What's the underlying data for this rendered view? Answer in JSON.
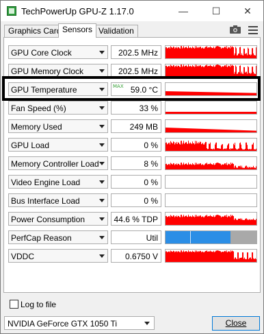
{
  "window": {
    "title": "TechPowerUp GPU-Z 1.17.0",
    "minimize_glyph": "—",
    "maximize_glyph": "☐",
    "close_glyph": "✕"
  },
  "tabs": [
    {
      "label": "Graphics Card",
      "active": false
    },
    {
      "label": "Sensors",
      "active": true
    },
    {
      "label": "Validation",
      "active": false
    }
  ],
  "toolbar": {
    "camera_icon": "camera-icon",
    "menu_icon": "menu-icon"
  },
  "colors": {
    "graph_red": "#ff0000",
    "perfcap_blue": "#2b8ee6",
    "perfcap_gray": "#a9a9a9",
    "max_tag_green": "#3aa23a"
  },
  "sensors": [
    {
      "label": "GPU Core Clock",
      "value": "202.5 MHz",
      "max_tag": "",
      "graph": "core"
    },
    {
      "label": "GPU Memory Clock",
      "value": "202.5 MHz",
      "max_tag": "",
      "graph": "memclock"
    },
    {
      "label": "GPU Temperature",
      "value": "59.0 °C",
      "max_tag": "MAX",
      "graph": "temp",
      "highlighted": true
    },
    {
      "label": "Fan Speed (%)",
      "value": "33 %",
      "max_tag": "",
      "graph": "fan"
    },
    {
      "label": "Memory Used",
      "value": "249 MB",
      "max_tag": "",
      "graph": "memused"
    },
    {
      "label": "GPU Load",
      "value": "0 %",
      "max_tag": "",
      "graph": "load"
    },
    {
      "label": "Memory Controller Load",
      "value": "8 %",
      "max_tag": "",
      "graph": "mcload"
    },
    {
      "label": "Video Engine Load",
      "value": "0 %",
      "max_tag": "",
      "graph": "empty"
    },
    {
      "label": "Bus Interface Load",
      "value": "0 %",
      "max_tag": "",
      "graph": "empty"
    },
    {
      "label": "Power Consumption",
      "value": "44.6 % TDP",
      "max_tag": "",
      "graph": "power"
    },
    {
      "label": "PerfCap Reason",
      "value": "Util",
      "max_tag": "",
      "graph": "perfcap"
    },
    {
      "label": "VDDC",
      "value": "0.6750 V",
      "max_tag": "",
      "graph": "vddc"
    }
  ],
  "footer": {
    "log_label": "Log to file",
    "log_checked": false,
    "gpu_selected": "NVIDIA GeForce GTX 1050 Ti",
    "close_label": "Close"
  }
}
